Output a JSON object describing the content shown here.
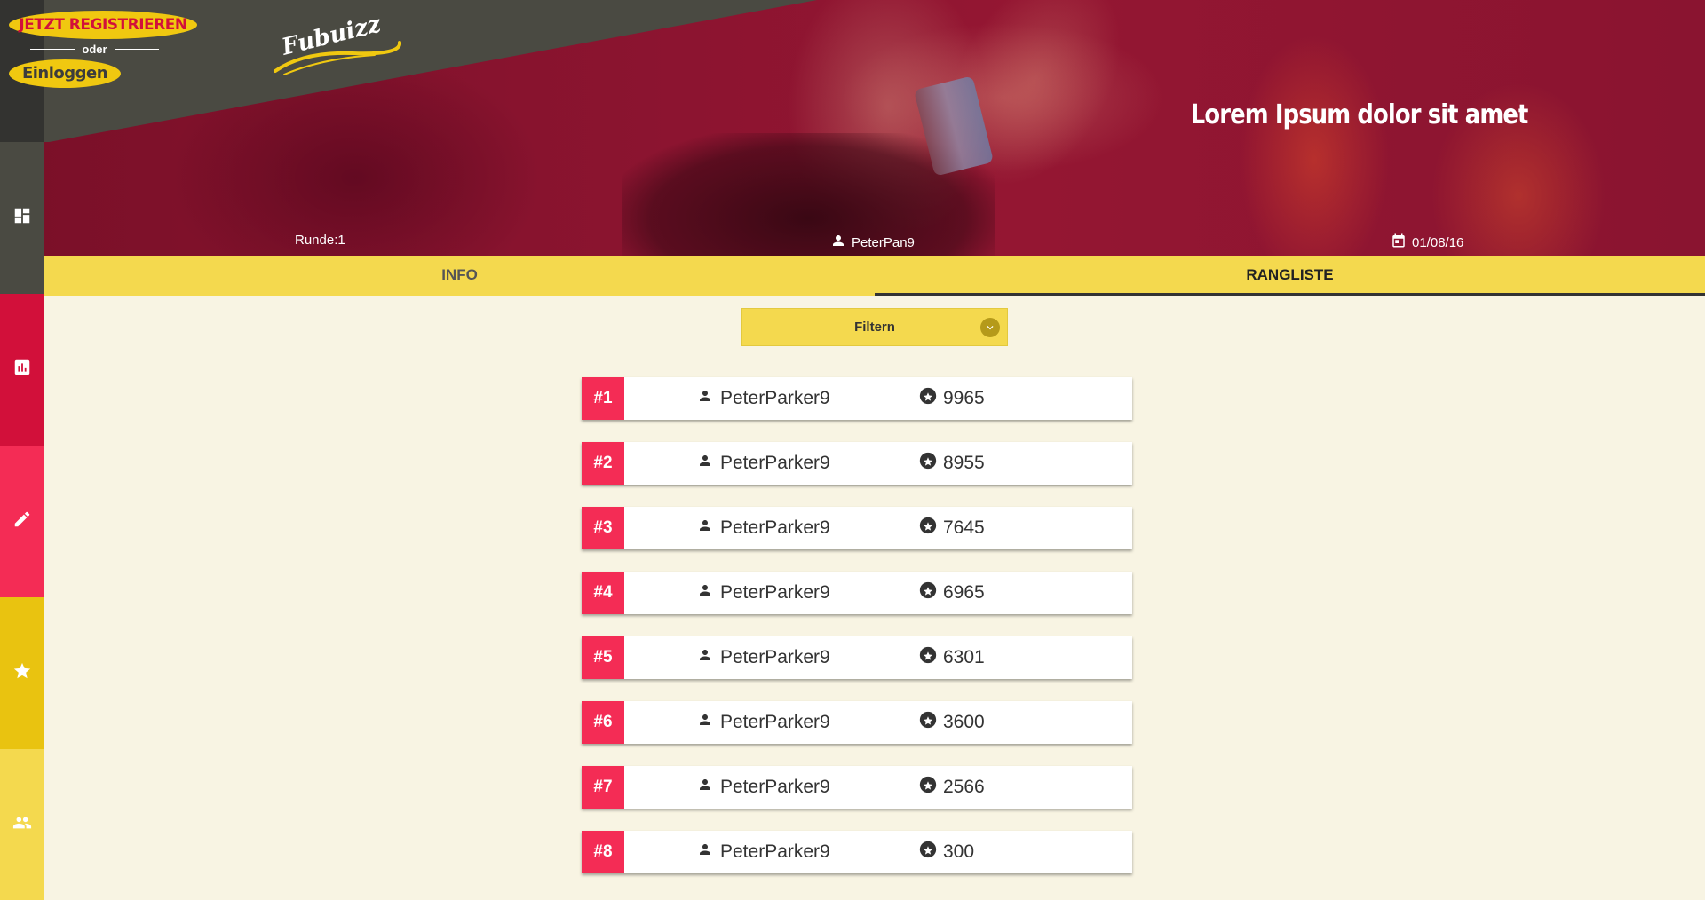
{
  "auth": {
    "register_label": "JETZT REGISTRIEREN",
    "or_label": "oder",
    "login_label": "Einloggen"
  },
  "logo": {
    "text": "Fubuizz"
  },
  "hero": {
    "title": "Lorem Ipsum dolor sit amet",
    "round": "Runde:1",
    "user": "PeterPan9",
    "date": "01/08/16"
  },
  "sidebar": {
    "items": [
      {
        "icon": "dashboard-icon",
        "color": "#4a4a42"
      },
      {
        "icon": "bar-chart-icon",
        "color": "#d2103a"
      },
      {
        "icon": "pencil-icon",
        "color": "#f42c55"
      },
      {
        "icon": "star-icon",
        "color": "#e9c310"
      },
      {
        "icon": "group-icon",
        "color": "#f4d94e"
      }
    ]
  },
  "tabs": [
    {
      "label": "INFO",
      "active": false
    },
    {
      "label": "RANGLISTE",
      "active": true
    }
  ],
  "filter": {
    "label": "Filtern"
  },
  "ranking": [
    {
      "rank": "#1",
      "user": "PeterParker9",
      "score": "9965"
    },
    {
      "rank": "#2",
      "user": "PeterParker9",
      "score": "8955"
    },
    {
      "rank": "#3",
      "user": "PeterParker9",
      "score": "7645"
    },
    {
      "rank": "#4",
      "user": "PeterParker9",
      "score": "6965"
    },
    {
      "rank": "#5",
      "user": "PeterParker9",
      "score": "6301"
    },
    {
      "rank": "#6",
      "user": "PeterParker9",
      "score": "3600"
    },
    {
      "rank": "#7",
      "user": "PeterParker9",
      "score": "2566"
    },
    {
      "rank": "#8",
      "user": "PeterParker9",
      "score": "300"
    }
  ],
  "colors": {
    "accent_yellow": "#f4d94e",
    "accent_red": "#f42c55",
    "dark": "#4a4a42",
    "background": "#f8f4e3"
  }
}
